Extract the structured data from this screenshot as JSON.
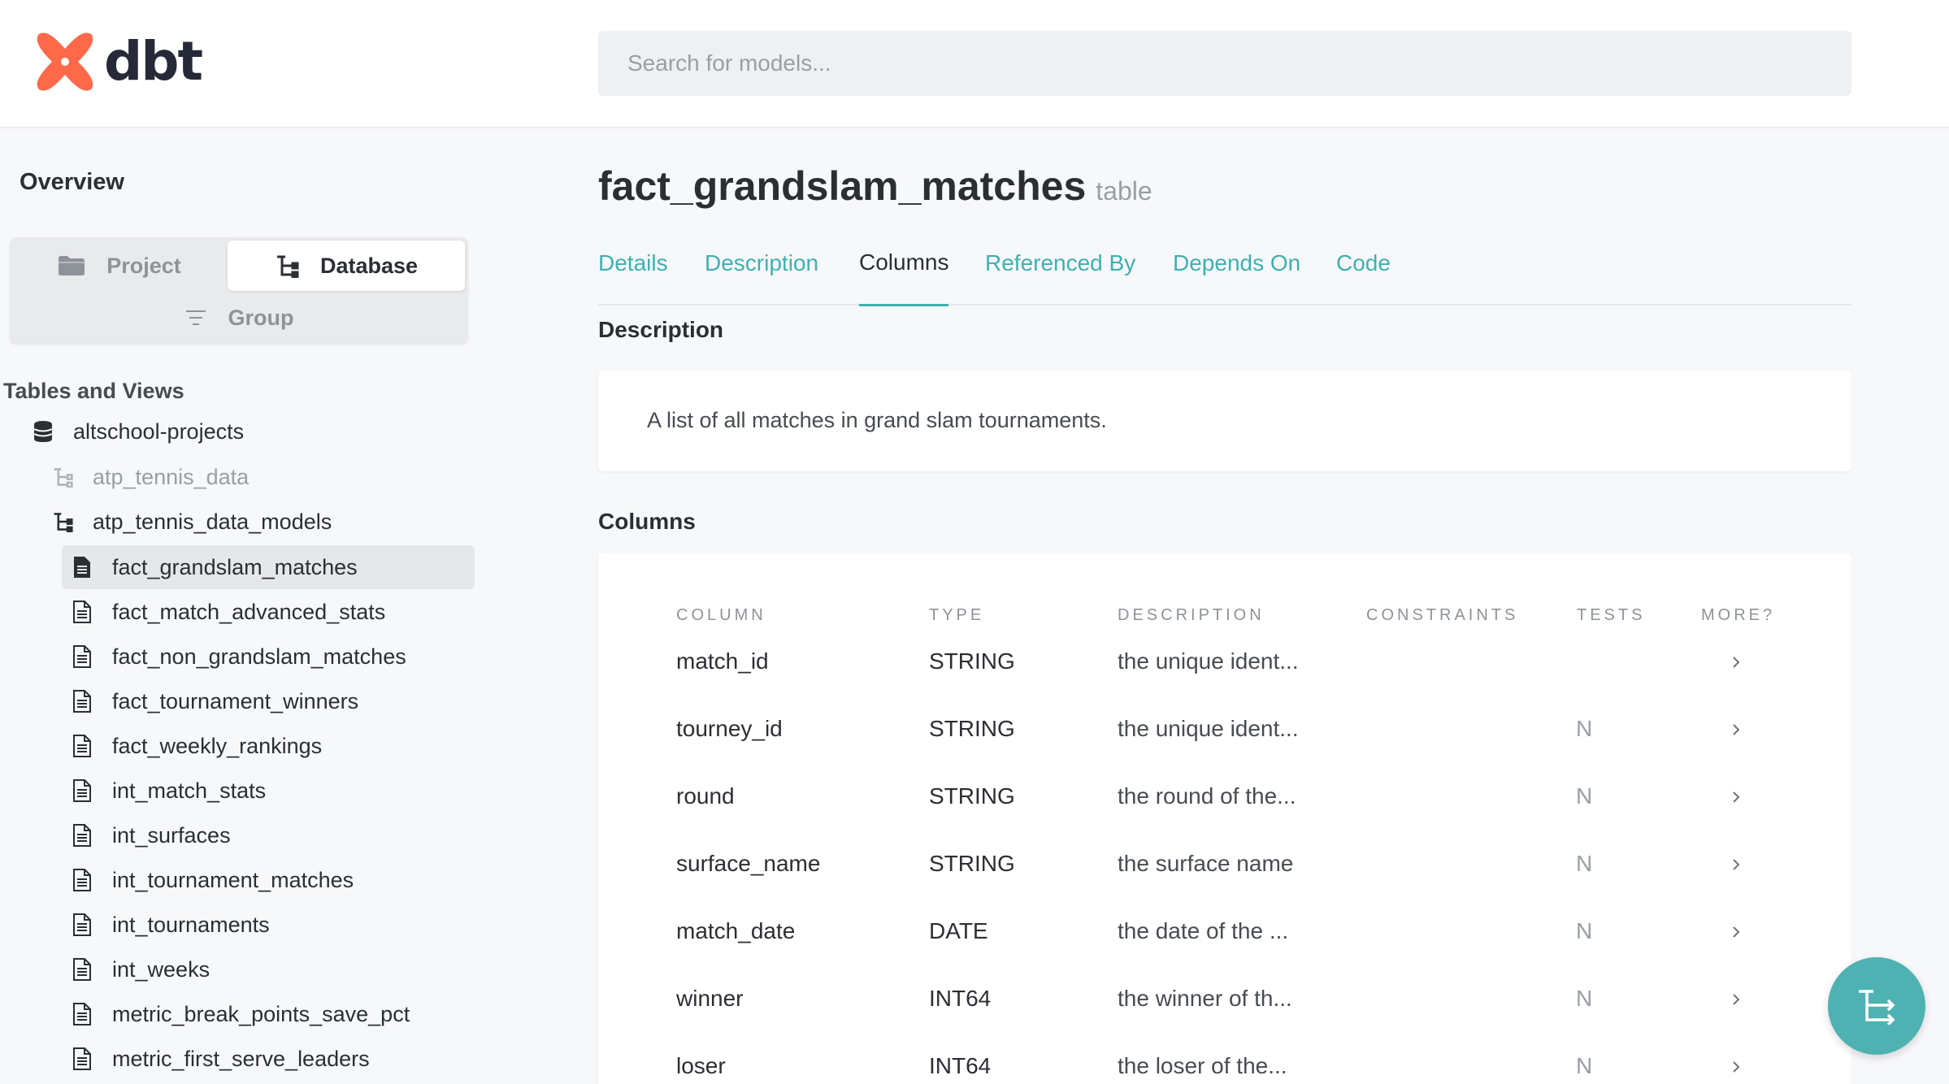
{
  "brand": {
    "name": "dbt",
    "accent": "#ff694a",
    "teal": "#3fb0b0"
  },
  "search": {
    "placeholder": "Search for models..."
  },
  "sidebar": {
    "overview_label": "Overview",
    "toggle": {
      "project": "Project",
      "database": "Database",
      "group": "Group",
      "active": "Database"
    },
    "section_title": "Tables and Views",
    "database": "altschool-projects",
    "schemas": [
      {
        "label": "atp_tennis_data",
        "expanded": false
      },
      {
        "label": "atp_tennis_data_models",
        "expanded": true
      }
    ],
    "models": [
      "fact_grandslam_matches",
      "fact_match_advanced_stats",
      "fact_non_grandslam_matches",
      "fact_tournament_winners",
      "fact_weekly_rankings",
      "int_match_stats",
      "int_surfaces",
      "int_tournament_matches",
      "int_tournaments",
      "int_weeks",
      "metric_break_points_save_pct",
      "metric_first_serve_leaders"
    ],
    "selected_model": "fact_grandslam_matches"
  },
  "main": {
    "title": "fact_grandslam_matches",
    "subtype": "table",
    "tabs": [
      "Details",
      "Description",
      "Columns",
      "Referenced By",
      "Depends On",
      "Code"
    ],
    "active_tab": "Columns",
    "description_heading": "Description",
    "description_text": "A list of all matches in grand slam tournaments.",
    "columns_heading": "Columns",
    "columns_table": {
      "headers": [
        "COLUMN",
        "TYPE",
        "DESCRIPTION",
        "CONSTRAINTS",
        "TESTS",
        "MORE?"
      ],
      "rows": [
        {
          "column": "match_id",
          "type": "STRING",
          "description": "the unique ident...",
          "constraints": "",
          "tests": ""
        },
        {
          "column": "tourney_id",
          "type": "STRING",
          "description": "the unique ident...",
          "constraints": "",
          "tests": "N"
        },
        {
          "column": "round",
          "type": "STRING",
          "description": "the round of the...",
          "constraints": "",
          "tests": "N"
        },
        {
          "column": "surface_name",
          "type": "STRING",
          "description": "the surface name",
          "constraints": "",
          "tests": "N"
        },
        {
          "column": "match_date",
          "type": "DATE",
          "description": "the date of the ...",
          "constraints": "",
          "tests": "N"
        },
        {
          "column": "winner",
          "type": "INT64",
          "description": "the winner of th...",
          "constraints": "",
          "tests": "N"
        },
        {
          "column": "loser",
          "type": "INT64",
          "description": "the loser of the...",
          "constraints": "",
          "tests": "N"
        }
      ]
    }
  },
  "fab": {
    "icon": "lineage-graph-icon"
  }
}
